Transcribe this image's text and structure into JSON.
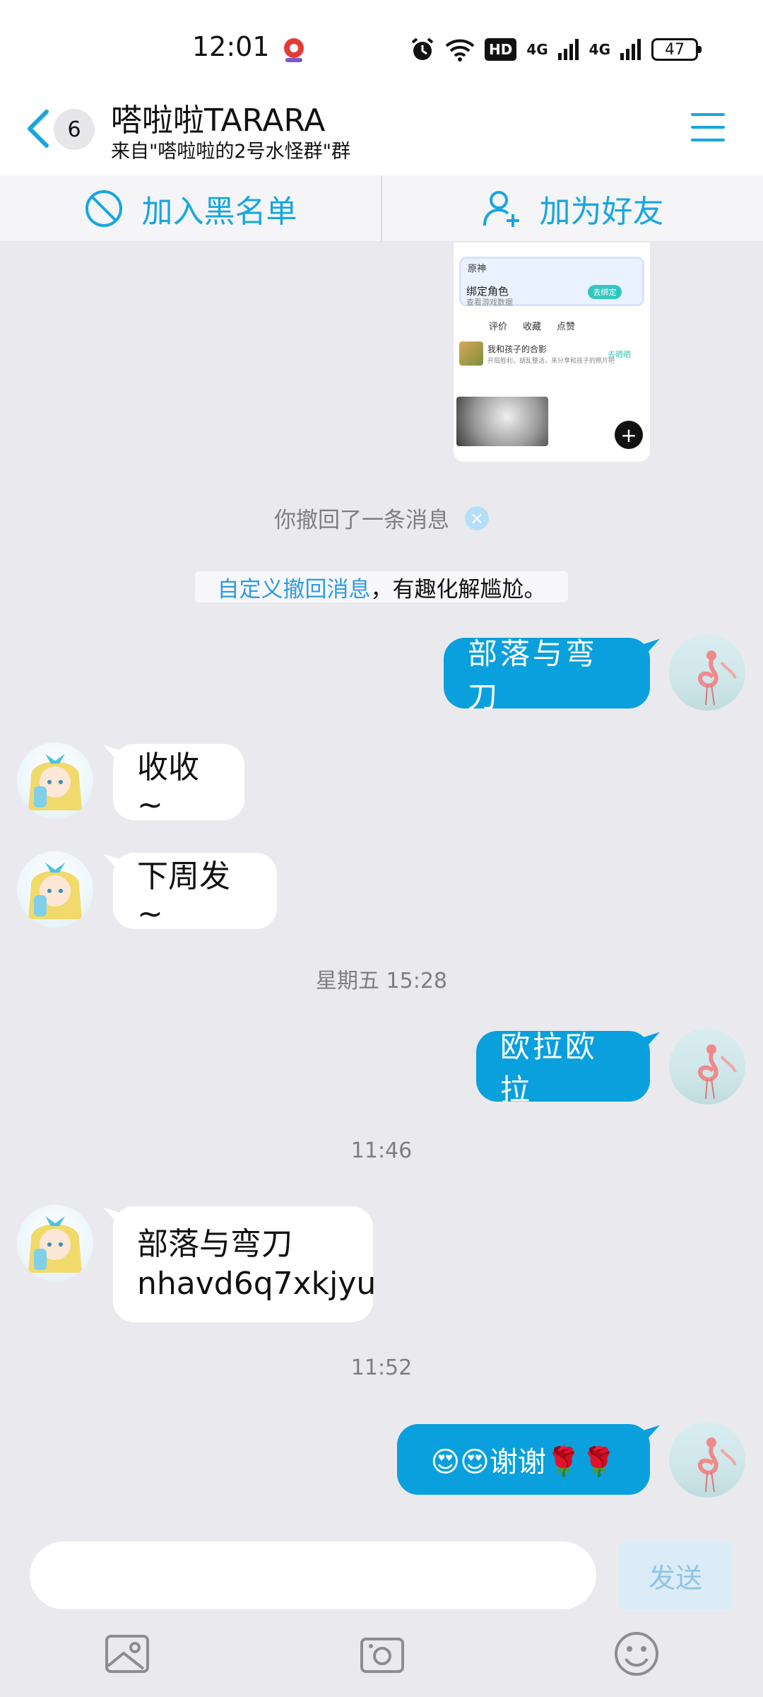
{
  "status_bar": {
    "time": "12:01",
    "hd_label": "HD",
    "net1": "4G",
    "net2": "4G",
    "battery": "47"
  },
  "header": {
    "back_count": "6",
    "title": "嗒啦啦TARARA",
    "subtitle": "来自\"嗒啦啦的2号水怪群\"群"
  },
  "actions": {
    "blacklist": "加入黑名单",
    "add_friend": "加为好友"
  },
  "shared_image": {
    "card_title": "原神",
    "card_label": "绑定角色",
    "card_sub": "查看游戏数据",
    "card_button": "去绑定",
    "tabs": [
      "评价",
      "收藏",
      "点赞"
    ],
    "row_title": "我和孩子的合影",
    "row_sub": "开局胜利，胡乱整活，来分享和孩子的照片吧",
    "row_button": "去晒晒"
  },
  "recall_notice": "你撤回了一条消息",
  "recall_tip": {
    "link": "自定义撤回消息",
    "text": "，有趣化解尴尬。"
  },
  "messages": [
    {
      "side": "me",
      "text": "部落与弯刀"
    },
    {
      "side": "other",
      "text": "收收~"
    },
    {
      "side": "other",
      "text": "下周发~"
    },
    {
      "side": "time",
      "text": "星期五 15:28"
    },
    {
      "side": "me",
      "text": "欧拉欧拉"
    },
    {
      "side": "time",
      "text": "11:46"
    },
    {
      "side": "other",
      "line1": "部落与弯刀",
      "line2": "nhavd6q7xkjyu"
    },
    {
      "side": "time",
      "text": "11:52"
    },
    {
      "side": "me",
      "text": "😍😍谢谢🌹🌹"
    }
  ],
  "composer": {
    "placeholder": "",
    "send_label": "发送"
  },
  "colors": {
    "accent": "#17a6df",
    "bubble_me": "#0aa0dd",
    "background": "#eaeaee"
  },
  "icons": [
    "back-icon",
    "menu-icon",
    "block-icon",
    "add-friend-icon",
    "image-icon",
    "camera-icon",
    "emoji-icon",
    "alarm-icon",
    "wifi-icon",
    "signal-icon"
  ]
}
